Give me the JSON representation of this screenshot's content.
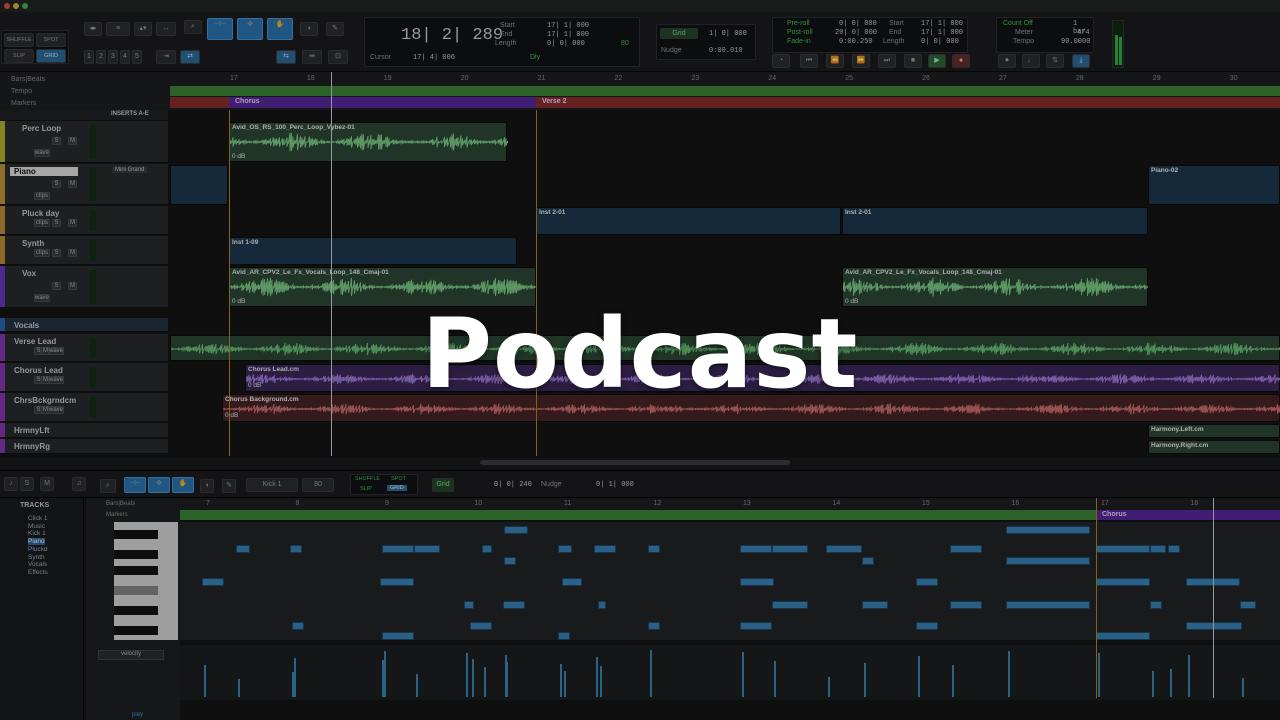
{
  "title_overlay": "Podcast",
  "toolbar": {
    "mode_shuffle": "SHUFFLE",
    "mode_spot": "SPOT",
    "mode_slip": "SLIP",
    "mode_grid": "GRID",
    "counter_main": "18| 2| 289",
    "start_label": "Start",
    "end_label": "End",
    "length_label": "Length",
    "start_val": "17| 1| 000",
    "end_val": "17| 1| 000",
    "length_val": "0| 0| 000",
    "cursor_label": "Cursor",
    "cursor_val": "17| 4| 006",
    "grid_label": "Grid",
    "grid_val": "1| 0| 000",
    "nudge_label": "Nudge",
    "nudge_val": "0:00.010",
    "preroll_label": "Pre-roll",
    "postroll_label": "Post-roll",
    "fadein_label": "Fade-in",
    "preroll_val": "0| 0| 000",
    "postroll_val": "20| 0| 000",
    "fadein_val": "0:00.250",
    "start2_val": "17| 1| 000",
    "end2_val": "17| 1| 000",
    "length2_val": "0| 0| 000",
    "countoff_label": "Count Off",
    "countoff_val": "1 bar",
    "meter_label": "Meter",
    "meter_val": "4/4",
    "tempo_label": "Tempo",
    "tempo_val": "90.0000",
    "num_1": "1",
    "num_2": "2",
    "num_3": "3",
    "num_4": "4",
    "num_5": "5",
    "dly": "Dly",
    "counter_small": "80"
  },
  "rulers": {
    "bars_beats": "Bars|Beats",
    "tempo": "Tempo",
    "markers": "Markers",
    "ticks": [
      "17",
      "18",
      "19",
      "20",
      "21",
      "22",
      "23",
      "24",
      "25",
      "26",
      "27",
      "28",
      "29",
      "30"
    ],
    "marker_chorus": "Chorus",
    "marker_verse2": "Verse 2"
  },
  "inserts_label": "INSERTS A-E",
  "tracks": [
    {
      "name": "Perc Loop",
      "color": "#b8b82a",
      "insert": "",
      "btn": "wave"
    },
    {
      "name": "Piano",
      "color": "#c49a3a",
      "insert": "Mini Grand",
      "btn": "clips"
    },
    {
      "name": "Pluck day",
      "color": "#c4903a",
      "insert": "",
      "btn": "clips"
    },
    {
      "name": "Synth",
      "color": "#c4903a",
      "insert": "",
      "btn": "clips"
    },
    {
      "name": "Vox",
      "color": "#6a3ac4",
      "insert": "",
      "btn": "wave"
    },
    {
      "name": "Vocals",
      "color": "#2a6ab8",
      "insert": "",
      "btn": ""
    },
    {
      "name": "Verse Lead",
      "color": "#8a3ab8",
      "insert": "",
      "btn": "wave"
    },
    {
      "name": "Chorus Lead",
      "color": "#8a3ab8",
      "insert": "",
      "btn": "wave"
    },
    {
      "name": "ChrsBckgrndcm",
      "color": "#8a3ab8",
      "insert": "",
      "btn": "wave"
    },
    {
      "name": "HrmnyLft",
      "color": "#8a3ab8",
      "insert": "",
      "btn": ""
    },
    {
      "name": "HrmnyRg",
      "color": "#8a3ab8",
      "insert": "",
      "btn": ""
    }
  ],
  "clips": {
    "perc": "Avid_OS_RS_100_Perc_Loop_Vybez-01",
    "perc_gain": "0 dB",
    "piano2": "Piano-02",
    "inst2a": "Inst 2-01",
    "inst2b": "Inst 2-01",
    "inst1": "Inst 1-09",
    "vox_a": "Avid_AR_CPV2_Le_Fx_Vocals_Loop_148_Cmaj-01",
    "vox_b": "Avid_AR_CPV2_Le_Fx_Vocals_Loop_148_Cmaj-01",
    "vox_gain": "0 dB",
    "chorus_lead": "Chorus Lead.cm",
    "chorus_lead_gain": "0 dB",
    "chorus_bg": "Chorus Background.cm",
    "chorus_bg_gain": "0 dB",
    "harm_left": "Harmony.Left.cm",
    "harm_right": "Harmony.Right.cm"
  },
  "midi_editor": {
    "s_btn": "S",
    "m_btn": "M",
    "kick_label": "Kick 1",
    "vel_num": "80",
    "grid_label": "Grid",
    "grid_val": "0| 0| 240",
    "nudge_label": "Nudge",
    "nudge_val": "0| 1| 000",
    "tracks_header": "TRACKS",
    "track_list": [
      "Click 1",
      "Music",
      "Kick 1",
      "Piano",
      "Pluckd",
      "Synth",
      "Vocals",
      "Effects"
    ],
    "bars_beats": "Bars|Beats",
    "markers": "Markers",
    "ticks": [
      "7",
      "8",
      "9",
      "10",
      "11",
      "12",
      "13",
      "14",
      "15",
      "16",
      "17",
      "18"
    ],
    "marker_chorus": "Chorus",
    "velocity_label": "velocity",
    "play_label": "play"
  }
}
